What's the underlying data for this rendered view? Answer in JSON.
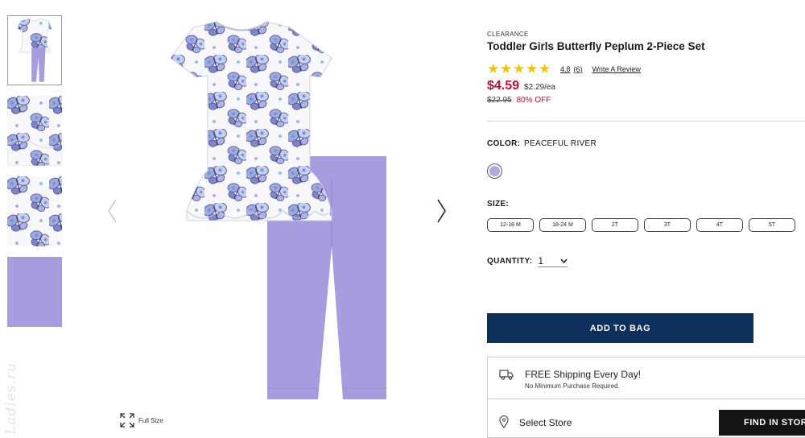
{
  "product": {
    "badge": "CLEARANCE",
    "title": "Toddler Girls Butterfly Peplum 2-Piece Set",
    "rating": {
      "value_text": "4.8",
      "count_text": "(6)",
      "value": 4.8,
      "max": 5,
      "write_review": "Write A Review"
    },
    "price": {
      "current": "$4.59",
      "unit": "$2.29/ea",
      "original": "$22.95",
      "discount": "80% OFF"
    },
    "color": {
      "label": "COLOR:",
      "value": "PEACEFUL RIVER",
      "swatch_hex": "#b4a6e0"
    },
    "size": {
      "label": "SIZE:",
      "options": [
        "12-18 M",
        "18-24 M",
        "2T",
        "3T",
        "4T",
        "5T"
      ]
    },
    "quantity": {
      "label": "QUANTITY:",
      "value": "1"
    },
    "add_to_bag": "ADD TO BAG",
    "shipping": {
      "title": "FREE Shipping Every Day!",
      "subtitle": "No Minimum Purchase Required."
    },
    "store": {
      "select_label": "Select Store",
      "find_button": "FIND IN STORE"
    }
  },
  "gallery": {
    "thumbnails": [
      "full-set",
      "top-print-detail",
      "butterfly-print-closeup",
      "leggings-color"
    ],
    "full_size_label": "Full Size"
  },
  "icons": {
    "prev": "chevron-left-icon",
    "next": "chevron-right-icon",
    "expand": "expand-icon",
    "truck": "truck-icon",
    "pin": "map-pin-icon",
    "star": "star-icon"
  },
  "colors": {
    "price_red": "#c40d35",
    "add_to_bag_navy": "#0d2f5c",
    "star_gold": "#f2c600",
    "legging_lavender": "#a99be0"
  },
  "watermark": "Ladies.ru"
}
